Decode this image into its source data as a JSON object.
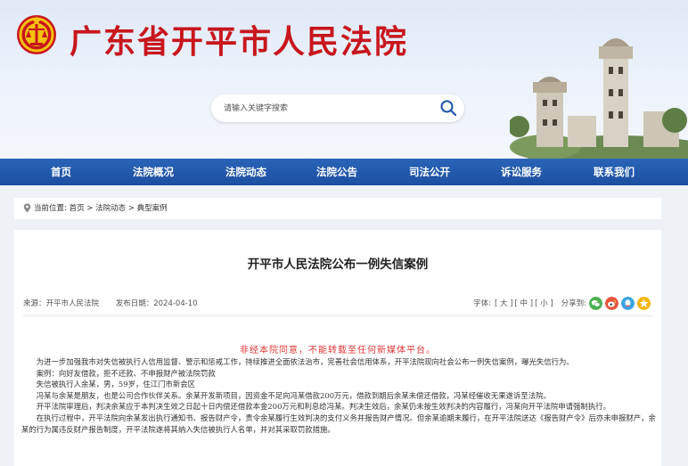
{
  "header": {
    "site_title": "广东省开平市人民法院",
    "search_placeholder": "请输入关键字搜索"
  },
  "nav": {
    "items": [
      "首页",
      "法院概况",
      "法院动态",
      "法院公告",
      "司法公开",
      "诉讼服务",
      "联系我们"
    ]
  },
  "breadcrumb": {
    "label": "当前位置:",
    "items": [
      "首页",
      "法院动态",
      "典型案例"
    ],
    "separator": " > "
  },
  "article": {
    "title": "开平市人民法院公布一例失信案例",
    "source": "来源：开平市人民法院",
    "date": "发布日期：2024-04-10",
    "font_label": "字体:",
    "font_sizes": [
      "[ 大 ]",
      "[ 中 ]",
      "[ 小 ]"
    ],
    "share_label": "分享到:",
    "share_icons": [
      "wechat-icon",
      "weibo-icon",
      "qq-icon",
      "qzone-icon"
    ],
    "share_colors": [
      "#4caf50",
      "#e8533c",
      "#3aa3e3",
      "#f4b400"
    ],
    "notice": "非经本院同意，不能转载至任何新媒体平台。",
    "paragraphs": [
      "为进一步加强我市对失信被执行人信用监督、警示和惩戒工作，持续推进全面依法治市，完善社会信用体系，开平法院现向社会公布一例失信案例，曝光失信行为。",
      "案例：向好友借款，拒不还款、不申报财产被法院罚款",
      "失信被执行人余某，男，59岁，住江门市新会区",
      "冯某与余某是朋友，也是公司合作伙伴关系。余某开发新项目，因资金不足向冯某借款200万元，借款到期后余某未偿还借款，冯某经催收无果遂诉至法院。",
      "开平法院审理后，判决余某应于本判决生效之日起十日内偿还借款本金200万元和利息给冯某。判决生效后，余某仍未按生效判决的内容履行，冯某向开平法院申请强制执行。",
      "在执行过程中，开平法院向余某发出执行通知书、报告财产令，责令余某履行生效判决的支付义务并报告财产情况。但余某逾期未履行，在开平法院送达《报告财产令》后亦未申报财产，余某的行为属违反财产报告制度，开平法院遂将其纳入失信被执行人名单，并对其采取罚款措施。"
    ]
  },
  "colors": {
    "title_red": "#c8161d",
    "nav_blue": "#1f56a8",
    "notice_red": "#e23636"
  }
}
